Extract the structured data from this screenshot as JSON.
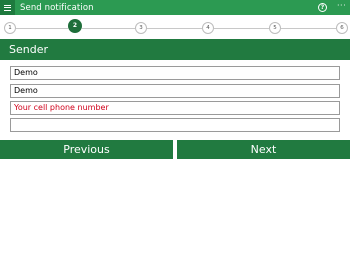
{
  "titlebar": {
    "title": "Send notification",
    "help_glyph": "?",
    "more_glyph": "···",
    "menu_icon": "hamburger-icon"
  },
  "stepper": {
    "steps": [
      "1",
      "2",
      "3",
      "4",
      "5",
      "6"
    ],
    "active_step": "2"
  },
  "section": {
    "title": "Sender"
  },
  "form": {
    "field1_value": "Demo",
    "field2_value": "Demo",
    "field3_placeholder": "Your cell phone number",
    "field4_value": ""
  },
  "buttons": {
    "previous": "Previous",
    "next": "Next"
  },
  "colors": {
    "titlebar": "#2c9a52",
    "accent": "#217a40",
    "placeholder": "#d0021b"
  }
}
